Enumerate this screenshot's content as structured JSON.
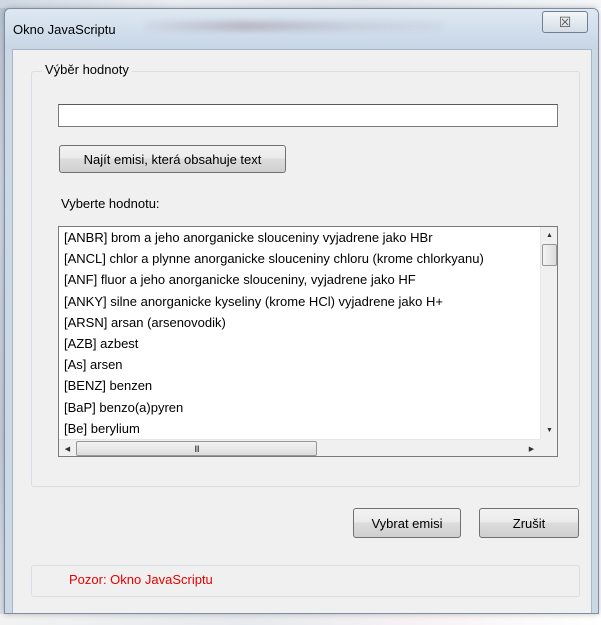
{
  "window": {
    "title": "Okno JavaScriptu",
    "close_glyph": "☒"
  },
  "group": {
    "title": "Výběr hodnoty",
    "search_value": "",
    "search_placeholder": "",
    "find_button_label": "Najít emisi, která obsahuje text",
    "list_label": "Vyberte hodnotu:",
    "items": [
      "[ANBR] brom a jeho anorganicke slouceniny vyjadrene jako HBr",
      "[ANCL] chlor a plynne anorganicke slouceniny chloru (krome chlorkyanu)",
      "[ANF] fluor a jeho anorganicke slouceniny, vyjadrene jako HF",
      "[ANKY] silne anorganicke kyseliny (krome HCl) vyjadrene jako H+",
      "[ARSN] arsan (arsenovodik)",
      "[AZB] azbest",
      "[As] arsen",
      "[BENZ] benzen",
      "[BaP] benzo(a)pyren",
      "[Be] berylium"
    ],
    "hscroll_grip": "III"
  },
  "buttons": {
    "select_label": "Vybrat emisi",
    "cancel_label": "Zrušit"
  },
  "status": {
    "message": "Pozor: Okno JavaScriptu",
    "color": "#e60000"
  },
  "icons": {
    "scroll_up": "▲",
    "scroll_down": "▼",
    "scroll_left": "◀",
    "scroll_right": "▶"
  }
}
